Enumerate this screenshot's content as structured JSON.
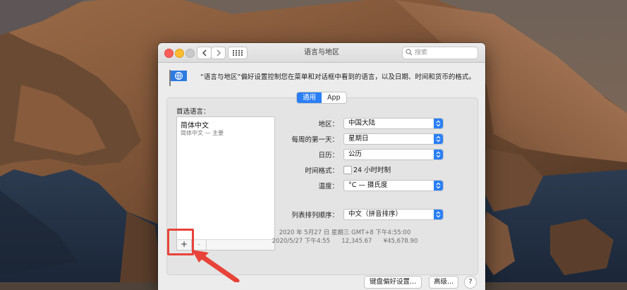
{
  "window": {
    "title": "语言与地区",
    "search_placeholder": "搜索"
  },
  "header": {
    "description": "“语言与地区”偏好设置控制您在菜单和对话框中看到的语言，以及日期、时间和货币的格式。"
  },
  "tabs": [
    {
      "label": "通用",
      "active": true
    },
    {
      "label": "App",
      "active": false
    }
  ],
  "languages": {
    "title": "首选语言：",
    "items": [
      {
        "name": "简体中文",
        "sub": "简体中文 — 主要"
      }
    ],
    "add_label": "+",
    "remove_label": "-"
  },
  "settings": {
    "region": {
      "label": "地区：",
      "value": "中国大陆"
    },
    "first_day": {
      "label": "每周的第一天：",
      "value": "星期日"
    },
    "calendar": {
      "label": "日历：",
      "value": "公历"
    },
    "time_format": {
      "label": "时间格式：",
      "checkbox_label": "24 小时时制",
      "checked": false
    },
    "temperature": {
      "label": "温度：",
      "value": "°C — 摄氏度"
    },
    "sort_order": {
      "label": "列表排列顺序：",
      "value": "中文（拼音排序）"
    }
  },
  "samples": {
    "line1": "2020 年 5月27 日 星期三 GMT+8 下午4:55:00",
    "line2": "2020/5/27 下午4:55      12,345.67      ¥45,678.90"
  },
  "buttons": {
    "keyboard": "键盘偏好设置...",
    "advanced": "高级...",
    "help": "?"
  },
  "colors": {
    "accent": "#2a7ff6",
    "annotation": "#e8433a"
  }
}
